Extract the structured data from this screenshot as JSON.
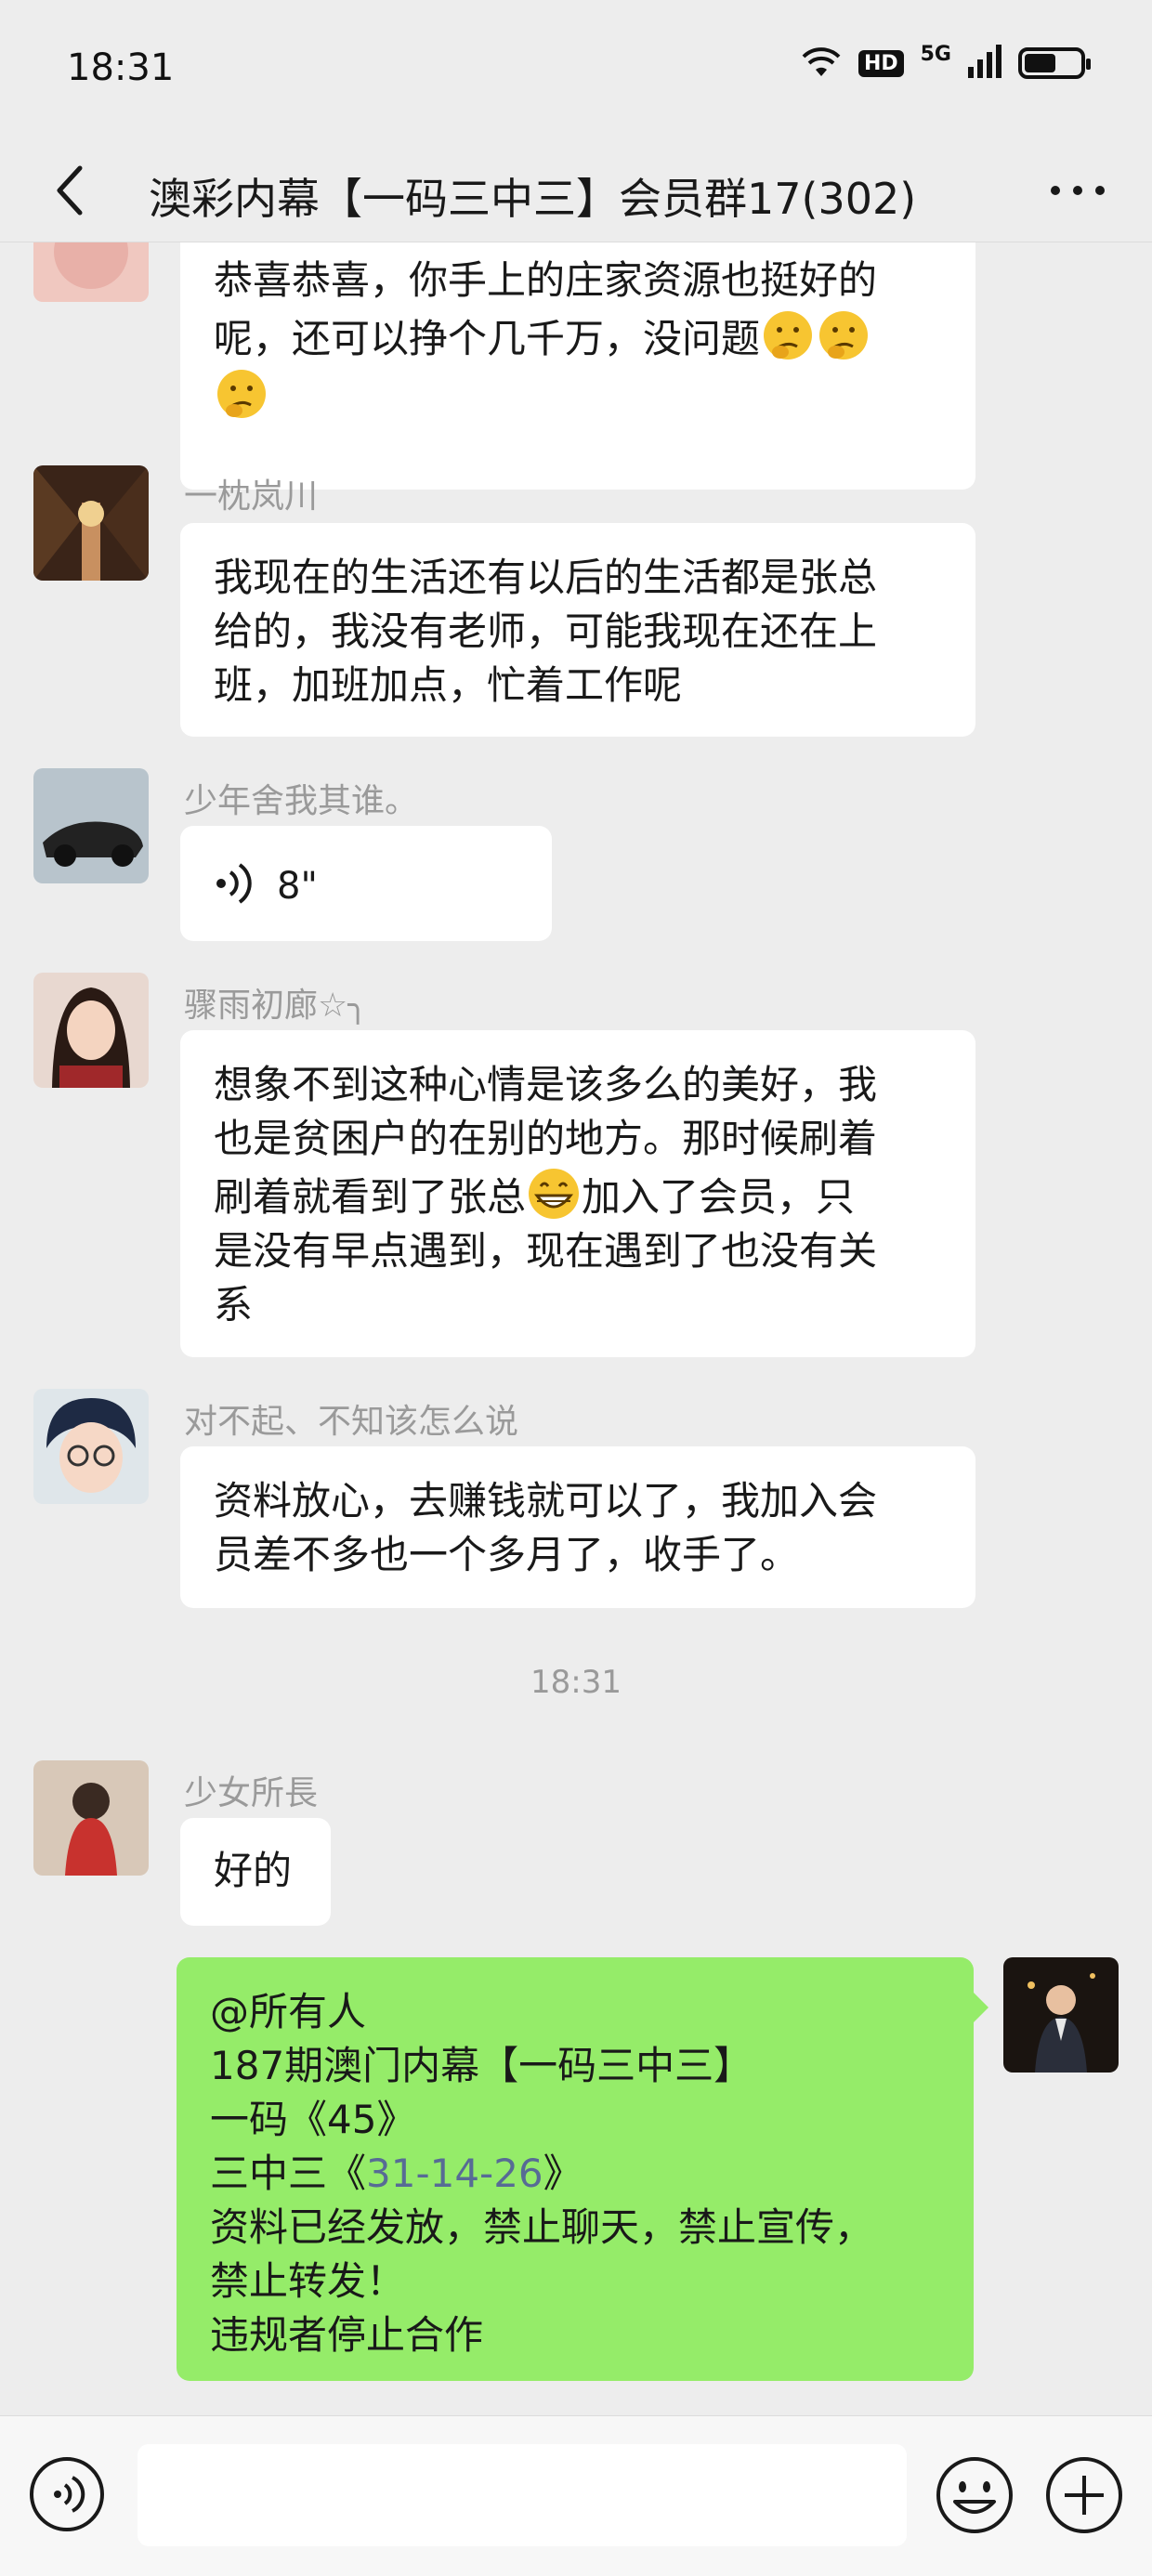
{
  "status_bar": {
    "time": "18:31",
    "hd": "HD",
    "network": "5G"
  },
  "nav": {
    "title": "澳彩内幕【一码三中三】会员群17(302)"
  },
  "messages": {
    "m1": {
      "lines": [
        "恭喜恭喜，你手上的庄家资源也挺好的",
        "呢，还可以挣个几千万，没问题"
      ]
    },
    "m2": {
      "sender": "一枕岚川",
      "lines": [
        "我现在的生活还有以后的生活都是张总",
        "给的，我没有老师，可能我现在还在上",
        "班，加班加点，忙着工作呢"
      ]
    },
    "m3": {
      "sender": "少年舍我其谁。",
      "voice_length": "8\""
    },
    "m4": {
      "sender": "骤雨初廊☆╮",
      "lines": [
        "想象不到这种心情是该多么的美好，我",
        "也是贫困户的在别的地方。那时候刷着",
        "刷着就看到了张总",
        "加入了会员，只",
        "是没有早点遇到，现在遇到了也没有关",
        "系"
      ]
    },
    "m5": {
      "sender": "对不起、不知该怎么说",
      "lines": [
        "资料放心，去赚钱就可以了，我加入会",
        "员差不多也一个多月了，收手了。"
      ]
    },
    "time_divider": "18:31",
    "m6": {
      "sender": "少女所長",
      "text": "好的"
    },
    "m7": {
      "lines": [
        "@所有人",
        "187期澳门内幕【一码三中三】",
        "一码《45》",
        "三中三《",
        "31-14-26",
        "》",
        "资料已经发放，禁止聊天，禁止宣传，",
        "禁止转发！",
        "违规者停止合作"
      ]
    }
  },
  "input": {
    "placeholder": "",
    "value": ""
  },
  "colors": {
    "background": "#ededed",
    "self_bubble": "#95ec69",
    "link": "#576b95"
  }
}
